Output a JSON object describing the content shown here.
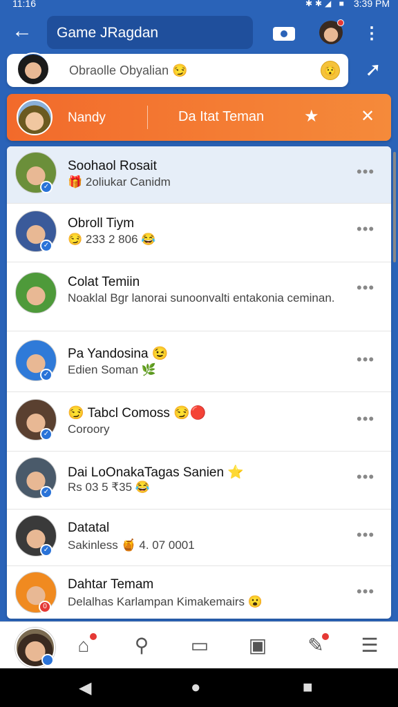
{
  "status": {
    "time": "11:16",
    "clock": "3:39 PM"
  },
  "appbar": {
    "title": "Game JRagdan"
  },
  "search": {
    "placeholder": "Obraolle Obyalian 😏"
  },
  "banner": {
    "name": "Nandy",
    "label": "Da Itat Teman"
  },
  "chats": [
    {
      "title": "Soohaol Rosait",
      "sub": "🎁 2oliukar Canidm",
      "avatar": "#6b8f3a"
    },
    {
      "title": "Obroll Tiym",
      "sub": "😏 233 2 806 😂",
      "avatar": "#3a5a9a"
    },
    {
      "title": "Colat Temiin",
      "sub": "Noaklal Bgr lanorai sunoonvalti entakonia ceminan.",
      "avatar": "#4e9a3a"
    },
    {
      "title": "Pa Yandosina 😉",
      "sub": "Edien Soman 🌿",
      "avatar": "#2f7ad8"
    },
    {
      "title": "😏 Tabcl Comoss 😏🔴",
      "sub": "Coroory",
      "avatar": "#5a4030"
    },
    {
      "title": "Dai LoOnakaTagas Sanien ⭐",
      "sub": "Rs 03 5 ₹35 😂",
      "avatar": "#4a5a6a"
    },
    {
      "title": "Datatal",
      "sub": "Sakinless 🍯 4. 07 0001",
      "avatar": "#3a3a3a"
    },
    {
      "title": "Dahtar Temam",
      "sub": "Delalhas Karlampan Kimakemairs 😮",
      "avatar": "#f08a20"
    }
  ]
}
